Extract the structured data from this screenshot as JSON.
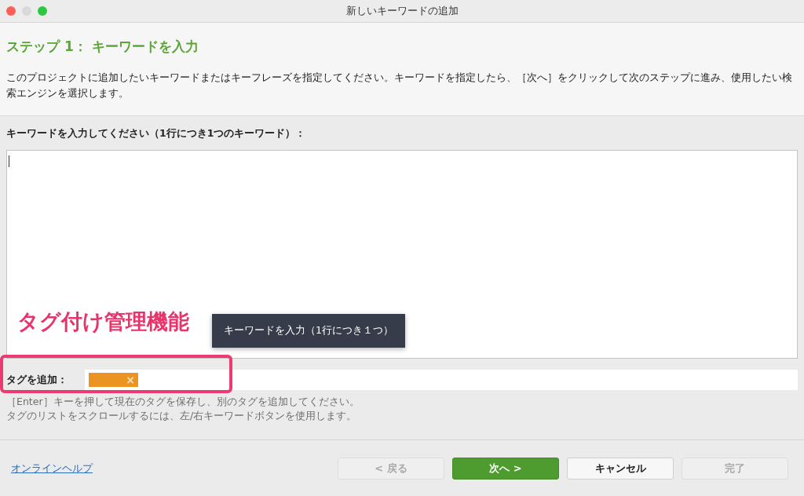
{
  "window": {
    "title": "新しいキーワードの追加"
  },
  "step": {
    "title": "ステップ 1： キーワードを入力",
    "description": "このプロジェクトに追加したいキーワードまたはキーフレーズを指定してください。キーワードを指定したら、［次へ］をクリックして次のステップに進み、使用したい検索エンジンを選択します。"
  },
  "keywords": {
    "label": "キーワードを入力してください（1行につき1つのキーワード）：",
    "focused": true,
    "tooltip": "キーワードを入力（1行につき１つ）"
  },
  "tags": {
    "label": "タグを追加：",
    "items": [
      {
        "color": "#ec9422",
        "remove": "×"
      }
    ]
  },
  "hints": [
    "［Enter］キーを押して現在のタグを保存し、別のタグを追加してください。",
    "タグのリストをスクロールするには、左/右キーワードボタンを使用します。"
  ],
  "help_link": "オンラインヘルプ",
  "buttons": [
    {
      "label": "< 戻る",
      "disabled": true,
      "primary": false
    },
    {
      "label": "次へ >",
      "disabled": false,
      "primary": true
    },
    {
      "label": "キャンセル",
      "disabled": false,
      "primary": false
    },
    {
      "label": "完了",
      "disabled": true,
      "primary": false
    }
  ],
  "annotation": {
    "text": "タグ付け管理機能"
  }
}
